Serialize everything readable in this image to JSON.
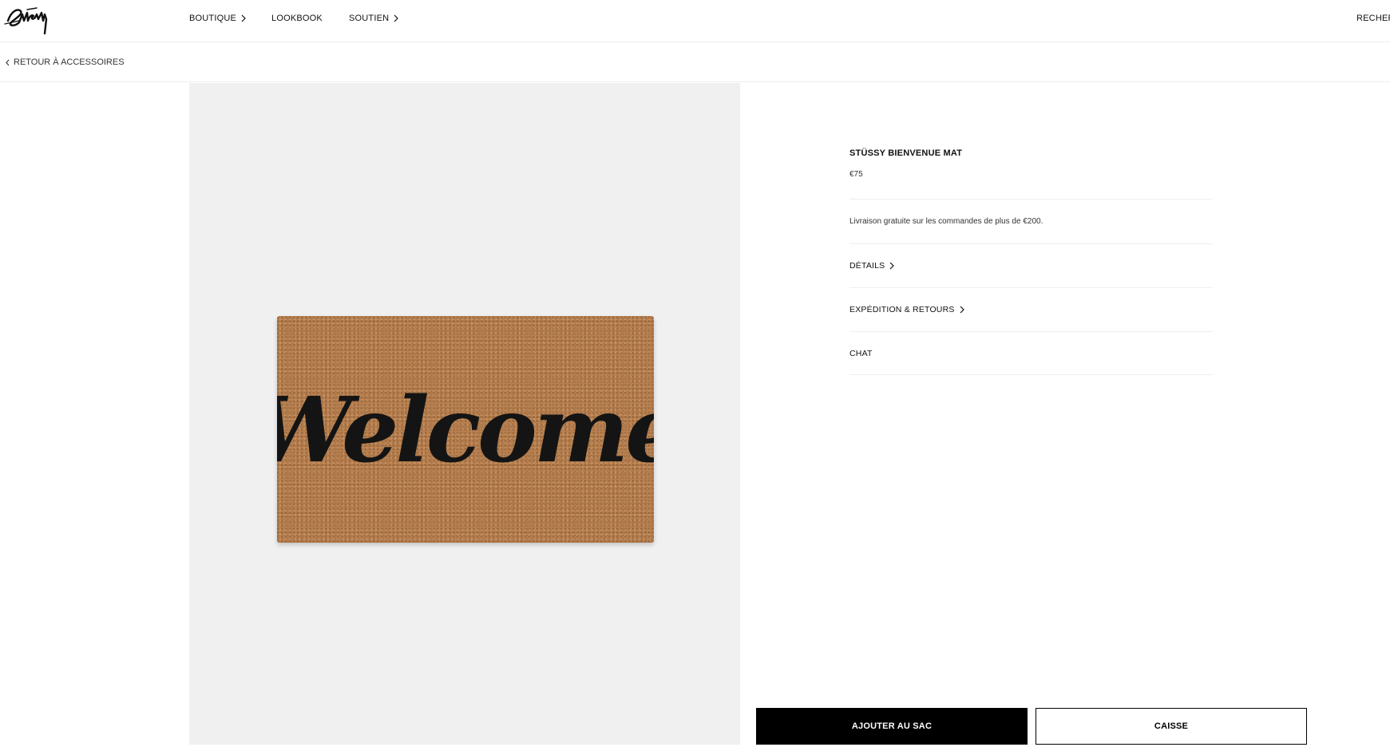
{
  "brand": {
    "logo_text": "Stüssy"
  },
  "nav": {
    "items": [
      {
        "label": "BOUTIQUE",
        "icon": "chevron-right-icon"
      },
      {
        "label": "LOOKBOOK"
      },
      {
        "label": "SOUTIEN",
        "icon": "chevron-right-icon"
      }
    ],
    "search_label": "RECHERC"
  },
  "breadcrumb": {
    "back_label": "RETOUR À ACCESSOIRES",
    "icon": "chevron-left-icon"
  },
  "product": {
    "name": "STÜSSY BIENVENUE MAT",
    "price": "€75",
    "shipping_note": "Livraison gratuite sur les commandes de plus de €200.",
    "image_text": "Welcome",
    "image_colors": {
      "mat": "#b98152",
      "lettering": "#141414",
      "backdrop": "#f0f0f0"
    },
    "sections": [
      {
        "label": "DÉTAILS",
        "icon": "chevron-right-icon"
      },
      {
        "label": "EXPÉDITION & RETOURS",
        "icon": "chevron-right-icon"
      },
      {
        "label": "CHAT"
      }
    ]
  },
  "actions": {
    "add_to_bag": "AJOUTER AU SAC",
    "checkout": "CAISSE"
  }
}
